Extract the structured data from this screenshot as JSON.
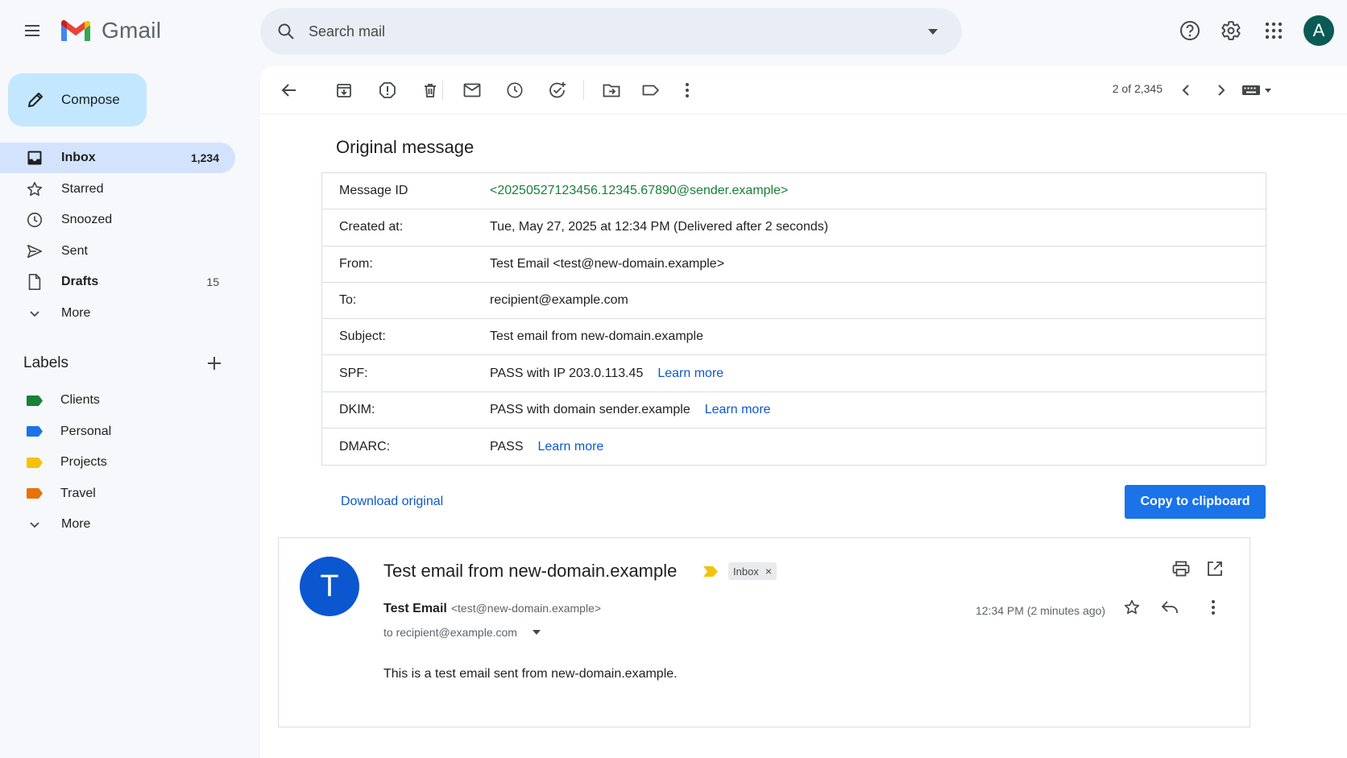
{
  "app": {
    "name": "Gmail",
    "avatar_initial": "A"
  },
  "search": {
    "placeholder": "Search mail"
  },
  "compose": {
    "label": "Compose"
  },
  "nav": [
    {
      "label": "Inbox",
      "count": "1,234"
    },
    {
      "label": "Starred",
      "count": ""
    },
    {
      "label": "Snoozed",
      "count": ""
    },
    {
      "label": "Sent",
      "count": ""
    },
    {
      "label": "Drafts",
      "count": "15"
    },
    {
      "label": "More",
      "count": ""
    }
  ],
  "labels": {
    "title": "Labels",
    "items": [
      {
        "label": "Clients",
        "color": "#188038"
      },
      {
        "label": "Personal",
        "color": "#1a73e8"
      },
      {
        "label": "Projects",
        "color": "#f4c20d"
      },
      {
        "label": "Travel",
        "color": "#e8710a"
      }
    ],
    "more": "More"
  },
  "toolbar": {
    "pager": "2 of 2,345"
  },
  "original": {
    "title": "Original message",
    "rows": [
      {
        "key": "Message ID",
        "value": "<20250527123456.12345.67890@sender.example>",
        "link": ""
      },
      {
        "key": "Created at:",
        "value": "Tue, May 27, 2025 at 12:34 PM (Delivered after 2 seconds)",
        "link": ""
      },
      {
        "key": "From:",
        "value": "Test Email <test@new-domain.example>",
        "link": ""
      },
      {
        "key": "To:",
        "value": "recipient@example.com",
        "link": ""
      },
      {
        "key": "Subject:",
        "value": "Test email from new-domain.example",
        "link": ""
      },
      {
        "key": "SPF:",
        "value": "PASS with IP 203.0.113.45",
        "link": "Learn more"
      },
      {
        "key": "DKIM:",
        "value": "PASS with domain sender.example",
        "link": "Learn more"
      },
      {
        "key": "DMARC:",
        "value": "PASS",
        "link": "Learn more"
      }
    ],
    "download_label": "Download original",
    "copy_label": "Copy to clipboard"
  },
  "message": {
    "avatar_initial": "T",
    "subject": "Test email from new-domain.example",
    "chip": "Inbox",
    "chip_close": "×",
    "sender_name": "Test Email",
    "sender_email": "<test@new-domain.example>",
    "to": "to recipient@example.com",
    "time": "12:34 PM (2 minutes ago)",
    "body": "This is a test email sent from new-domain.example."
  },
  "colors": {
    "accent": "#1a73e8",
    "compose_bg": "#c2e7ff",
    "active_nav_bg": "#d3e3fd",
    "message_id_green": "#188038",
    "link_blue": "#0b57d0",
    "avatar_top": "#0b5a55",
    "important_marker": "#f4c20d"
  }
}
